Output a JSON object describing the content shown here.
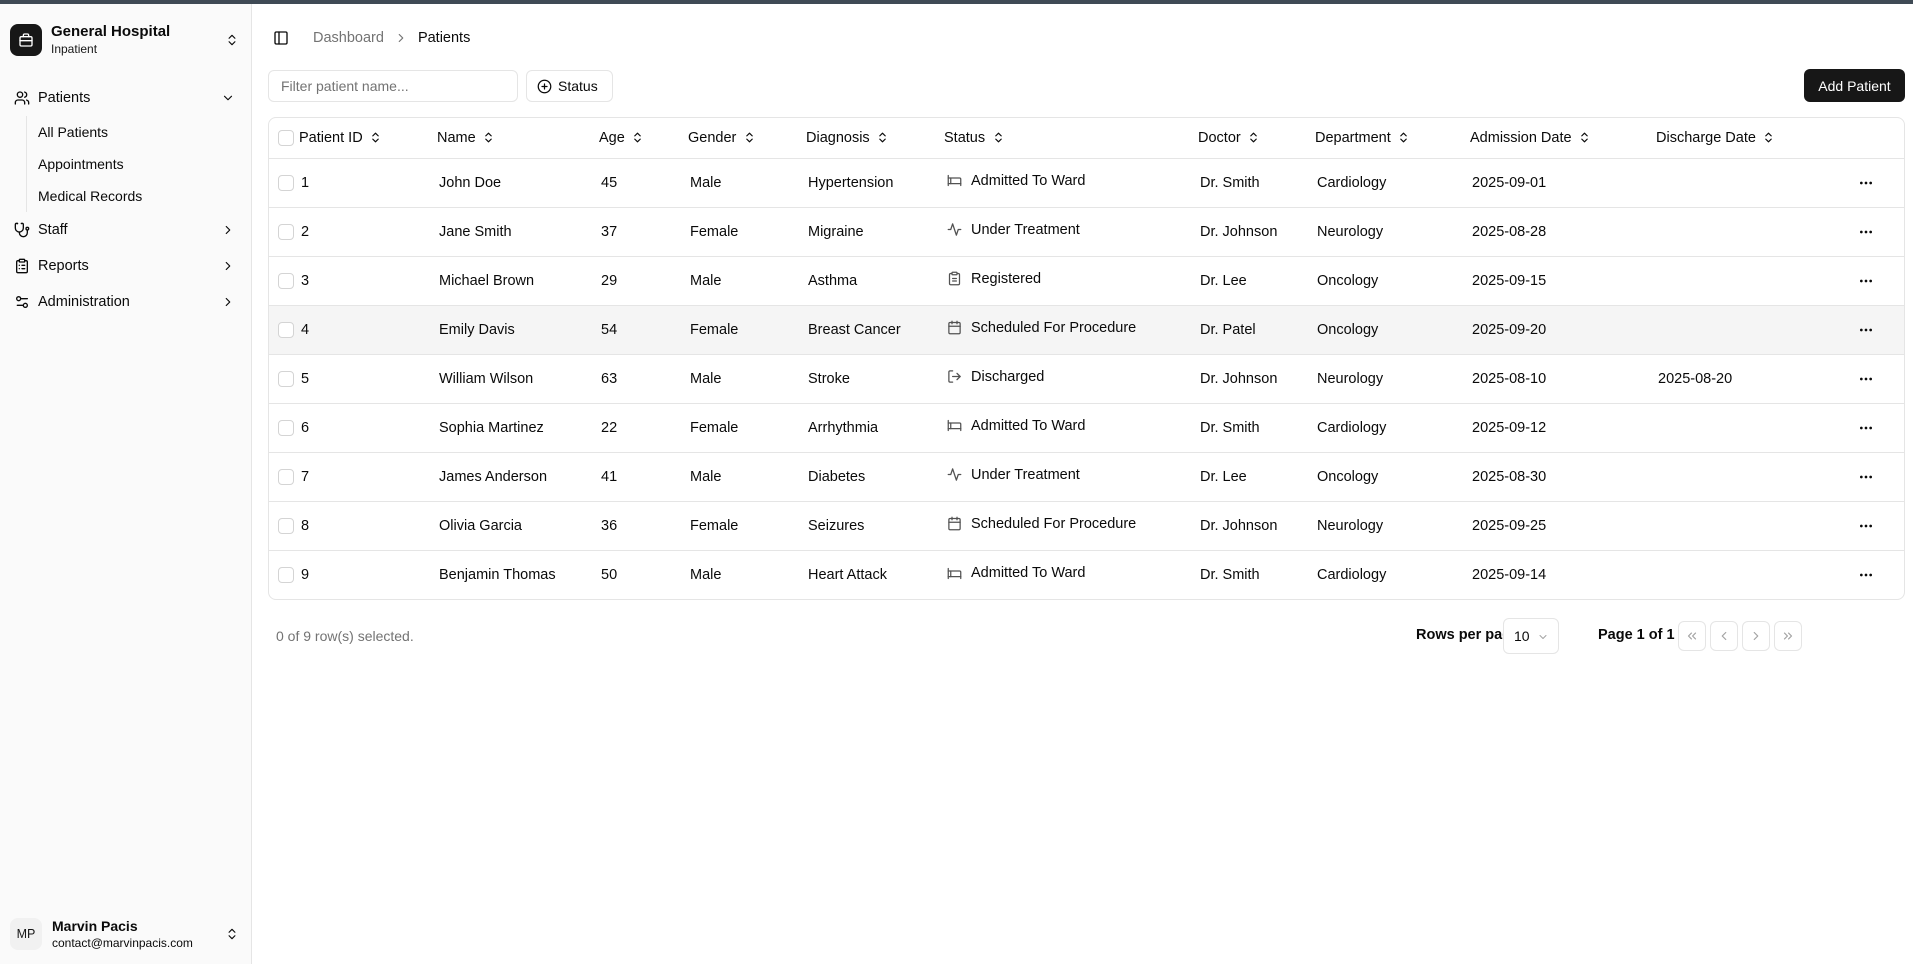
{
  "app": {
    "name": "General Hospital",
    "subtitle": "Inpatient"
  },
  "sidebar": {
    "patients": {
      "label": "Patients",
      "items": [
        "All Patients",
        "Appointments",
        "Medical Records"
      ]
    },
    "staff": "Staff",
    "reports": "Reports",
    "administration": "Administration"
  },
  "user": {
    "initials": "MP",
    "name": "Marvin Pacis",
    "email": "contact@marvinpacis.com"
  },
  "breadcrumb": {
    "parent": "Dashboard",
    "current": "Patients"
  },
  "toolbar": {
    "filter_placeholder": "Filter patient name...",
    "filter_value": "",
    "status_filter": "Status",
    "add_button": "Add Patient"
  },
  "table": {
    "columns": [
      "Patient ID",
      "Name",
      "Age",
      "Gender",
      "Diagnosis",
      "Status",
      "Doctor",
      "Department",
      "Admission Date",
      "Discharge Date"
    ],
    "rows": [
      {
        "id": "1",
        "name": "John Doe",
        "age": "45",
        "gender": "Male",
        "diagnosis": "Hypertension",
        "status": "Admitted To Ward",
        "status_icon": "bed-icon",
        "doctor": "Dr. Smith",
        "department": "Cardiology",
        "admission": "2025-09-01",
        "discharge": ""
      },
      {
        "id": "2",
        "name": "Jane Smith",
        "age": "37",
        "gender": "Female",
        "diagnosis": "Migraine",
        "status": "Under Treatment",
        "status_icon": "activity-icon",
        "doctor": "Dr. Johnson",
        "department": "Neurology",
        "admission": "2025-08-28",
        "discharge": ""
      },
      {
        "id": "3",
        "name": "Michael Brown",
        "age": "29",
        "gender": "Male",
        "diagnosis": "Asthma",
        "status": "Registered",
        "status_icon": "clipboard-icon",
        "doctor": "Dr. Lee",
        "department": "Oncology",
        "admission": "2025-09-15",
        "discharge": ""
      },
      {
        "id": "4",
        "name": "Emily Davis",
        "age": "54",
        "gender": "Female",
        "diagnosis": "Breast Cancer",
        "status": "Scheduled For Procedure",
        "status_icon": "calendar-icon",
        "doctor": "Dr. Patel",
        "department": "Oncology",
        "admission": "2025-09-20",
        "discharge": ""
      },
      {
        "id": "5",
        "name": "William Wilson",
        "age": "63",
        "gender": "Male",
        "diagnosis": "Stroke",
        "status": "Discharged",
        "status_icon": "log-out-icon",
        "doctor": "Dr. Johnson",
        "department": "Neurology",
        "admission": "2025-08-10",
        "discharge": "2025-08-20"
      },
      {
        "id": "6",
        "name": "Sophia Martinez",
        "age": "22",
        "gender": "Female",
        "diagnosis": "Arrhythmia",
        "status": "Admitted To Ward",
        "status_icon": "bed-icon",
        "doctor": "Dr. Smith",
        "department": "Cardiology",
        "admission": "2025-09-12",
        "discharge": ""
      },
      {
        "id": "7",
        "name": "James Anderson",
        "age": "41",
        "gender": "Male",
        "diagnosis": "Diabetes",
        "status": "Under Treatment",
        "status_icon": "activity-icon",
        "doctor": "Dr. Lee",
        "department": "Oncology",
        "admission": "2025-08-30",
        "discharge": ""
      },
      {
        "id": "8",
        "name": "Olivia Garcia",
        "age": "36",
        "gender": "Female",
        "diagnosis": "Seizures",
        "status": "Scheduled For Procedure",
        "status_icon": "calendar-icon",
        "doctor": "Dr. Johnson",
        "department": "Neurology",
        "admission": "2025-09-25",
        "discharge": ""
      },
      {
        "id": "9",
        "name": "Benjamin Thomas",
        "age": "50",
        "gender": "Male",
        "diagnosis": "Heart Attack",
        "status": "Admitted To Ward",
        "status_icon": "bed-icon",
        "doctor": "Dr. Smith",
        "department": "Cardiology",
        "admission": "2025-09-14",
        "discharge": ""
      }
    ]
  },
  "footer": {
    "selection": "0 of 9 row(s) selected.",
    "rows_per_page_label": "Rows per page",
    "rows_per_page": "10",
    "page_info": "Page 1 of 1"
  },
  "colors": {
    "primary": "#171717",
    "muted_text": "#737373",
    "border": "#e5e5e5",
    "sidebar_bg": "#fafafa"
  }
}
